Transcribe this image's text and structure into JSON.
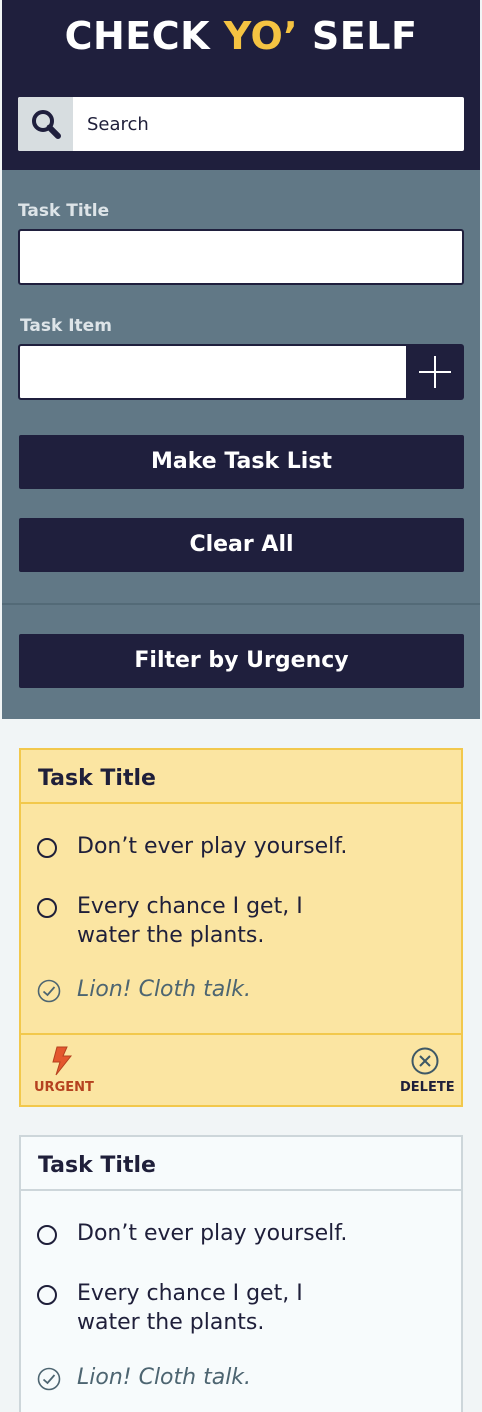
{
  "header": {
    "title_part1": "CHECK ",
    "title_accent": "YO’",
    "title_part2": " SELF",
    "accent_color": "#f5c342",
    "search_icon": "search-icon",
    "search_placeholder": "Search"
  },
  "form": {
    "task_title_label": "Task Title",
    "task_title_value": "",
    "task_item_label": "Task Item",
    "task_item_value": "",
    "add_icon": "plus-icon",
    "make_task_list_label": "Make Task List",
    "clear_all_label": "Clear All",
    "filter_label": "Filter by Urgency"
  },
  "cards": [
    {
      "title": "Task Title",
      "urgent": true,
      "items": [
        {
          "text": "Don’t ever play yourself.",
          "done": false
        },
        {
          "text": "Every chance I get, I water the plants.",
          "done": false
        },
        {
          "text": "Lion! Cloth talk.",
          "done": true
        }
      ],
      "urgent_label": "URGENT",
      "urgent_icon": "lightning-icon",
      "delete_label": "DELETE",
      "delete_icon": "close-circle-icon"
    },
    {
      "title": "Task Title",
      "urgent": false,
      "items": [
        {
          "text": "Don’t ever play yourself.",
          "done": false
        },
        {
          "text": "Every chance I get, I water the plants.",
          "done": false
        },
        {
          "text": "Lion! Cloth talk.",
          "done": true
        }
      ]
    }
  ],
  "colors": {
    "navy": "#1f1f3d",
    "panel": "#617886",
    "urgent_card": "#fbe5a2",
    "urgent_border": "#f2c84c",
    "urgent_text": "#b5411f"
  }
}
